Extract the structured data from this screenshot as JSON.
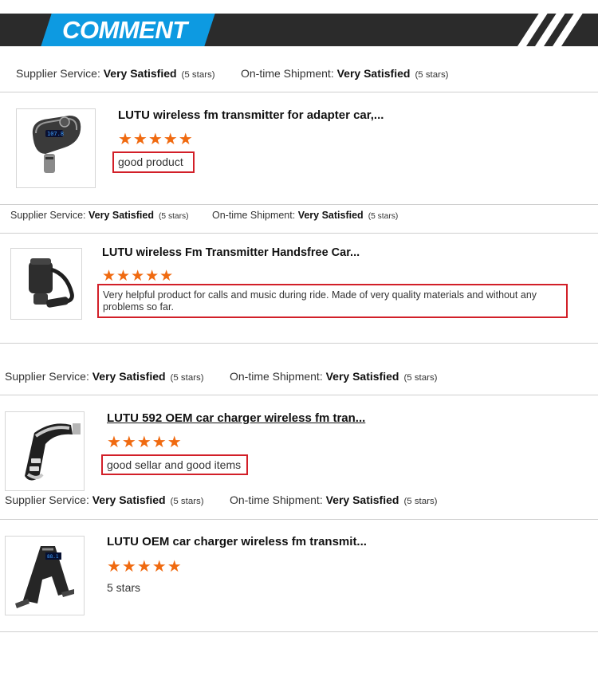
{
  "header": {
    "title": "COMMENT"
  },
  "labels": {
    "supplier": "Supplier Service:",
    "shipment": "On-time Shipment:",
    "value": "Very Satisfied",
    "stars_note": "(5 stars)"
  },
  "reviews": [
    {
      "title": "LUTU  wireless  fm transmitter for adapter car,...",
      "rating": 5,
      "comment": "good product"
    },
    {
      "title": "LUTU wireless Fm Transmitter Handsfree Car...",
      "rating": 5,
      "comment": "Very helpful product for calls and music during ride. Made of very quality materials and without any problems so far."
    },
    {
      "title": "LUTU 592 OEM        car charger wireless fm tran...",
      "rating": 5,
      "comment": "good sellar and good items"
    },
    {
      "title": "LUTU OEM        car charger wireless fm transmit...",
      "rating": 5,
      "comment": "5 stars"
    }
  ],
  "star_glyph": "★★★★★",
  "colors": {
    "accent": "#0d9ae1",
    "header_bg": "#2b2b2b",
    "star": "#f06a10",
    "highlight_border": "#d21f28"
  }
}
